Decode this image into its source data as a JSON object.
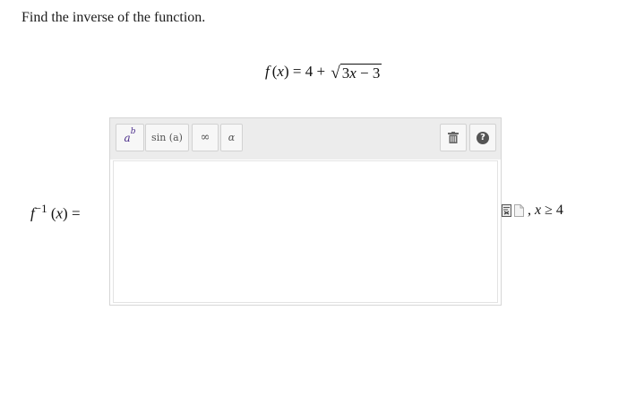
{
  "prompt": "Find the inverse of the function.",
  "equation": {
    "fname": "f",
    "lparen": "(",
    "var": "x",
    "rparen": ")",
    "equals": " = 4 + ",
    "radical_sign": "√",
    "radicand_left": "3",
    "radicand_var": "x",
    "radicand_right": " − 3"
  },
  "answer_label": {
    "fname": "f",
    "exponent": "−1",
    "lparen": " (",
    "var": "x",
    "rparen": ")",
    "equals": " ="
  },
  "toolbar": {
    "power_base": "a",
    "power_exp": "b",
    "sin_label": "sin (a)",
    "infinity_label": "∞",
    "alpha_label": "α",
    "help_label": "?"
  },
  "input": {
    "value": ""
  },
  "domain": {
    "separator": ",",
    "var": "x",
    "relation": " ≥ 4"
  },
  "icons": {
    "power": "power-template-icon",
    "trash": "trash-icon",
    "help": "help-icon",
    "preview": "preview-document-icon",
    "page": "page-icon"
  },
  "colors": {
    "toolbar_bg": "#ececec",
    "power_accent": "#4a2c8a",
    "help_circle": "#555555"
  }
}
